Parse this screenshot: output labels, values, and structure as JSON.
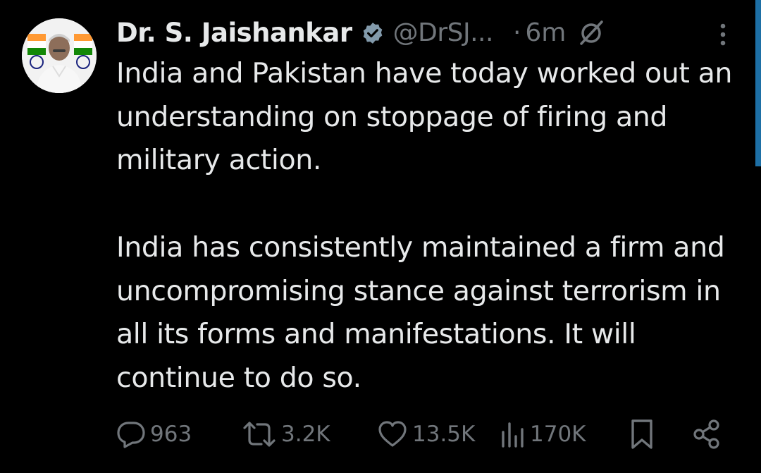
{
  "author": {
    "display_name": "Dr. S. Jaishankar",
    "handle": "@DrSJ...",
    "separator": "·",
    "time": "6m",
    "avatar_icon": "profile-photo",
    "verified_icon": "verified-badge-icon",
    "verified_color": "#829aab"
  },
  "tweet": {
    "paragraphs": [
      "India and Pakistan have today worked out an understanding on stoppage of firing and military action.",
      "India has consistently maintained a firm and uncompromising stance against terrorism in all its forms and manifestations. It will continue to do so."
    ]
  },
  "actions": {
    "replies": "963",
    "retweets": "3.2K",
    "likes": "13.5K",
    "views": "170K"
  },
  "theme": {
    "background": "#000000",
    "text": "#e7e9ea",
    "secondary": "#71767b",
    "scroll_accent": "#1d6fa5"
  }
}
